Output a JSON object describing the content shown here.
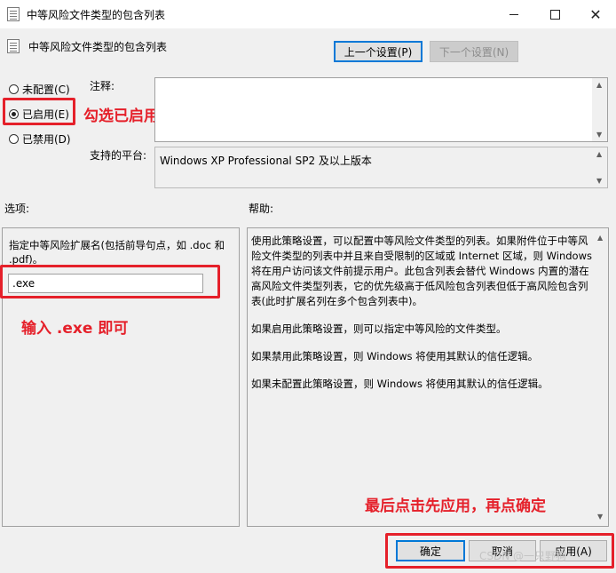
{
  "window": {
    "title": "中等风险文件类型的包含列表"
  },
  "header": {
    "title": "中等风险文件类型的包含列表",
    "prev_label": "上一个设置(P)",
    "next_label": "下一个设置(N)"
  },
  "radios": {
    "not_configured": "未配置(C)",
    "enabled": "已启用(E)",
    "disabled": "已禁用(D)",
    "selected": "enabled"
  },
  "comment": {
    "label": "注释:",
    "value": ""
  },
  "platform": {
    "label": "支持的平台:",
    "value": "Windows XP Professional SP2 及以上版本"
  },
  "options": {
    "label": "选项:",
    "desc": "指定中等风险扩展名(包括前导句点，如  .doc 和 .pdf)。",
    "value": ".exe"
  },
  "help": {
    "label": "帮助:",
    "paragraphs": [
      "使用此策略设置，可以配置中等风险文件类型的列表。如果附件位于中等风险文件类型的列表中并且来自受限制的区域或 Internet 区域，则 Windows 将在用户访问该文件前提示用户。此包含列表会替代 Windows 内置的潜在高风险文件类型列表，它的优先级高于低风险包含列表但低于高风险包含列表(此时扩展名列在多个包含列表中)。",
      "如果启用此策略设置，则可以指定中等风险的文件类型。",
      "如果禁用此策略设置，则 Windows 将使用其默认的信任逻辑。",
      "如果未配置此策略设置，则 Windows 将使用其默认的信任逻辑。"
    ]
  },
  "footer": {
    "ok_label": "确定",
    "cancel_label": "取消",
    "apply_label": "应用(A)"
  },
  "annotations": {
    "enable_hint": "勾选已启用",
    "input_hint": "输入 .exe 即可",
    "apply_hint": "最后点击先应用，再点确定"
  },
  "watermark": "CSDN @一只野狗",
  "colors": {
    "annotation_red": "#e5202a",
    "primary_border": "#0078d7"
  }
}
